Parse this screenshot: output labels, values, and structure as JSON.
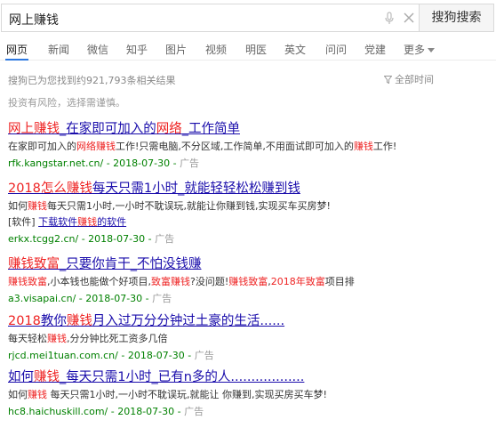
{
  "search": {
    "query": "网上赚钱",
    "button_label": "搜狗搜索"
  },
  "tabs": [
    {
      "label": "网页"
    },
    {
      "label": "新闻"
    },
    {
      "label": "微信"
    },
    {
      "label": "知乎"
    },
    {
      "label": "图片"
    },
    {
      "label": "视频"
    },
    {
      "label": "明医"
    },
    {
      "label": "英文"
    },
    {
      "label": "问问"
    },
    {
      "label": "党建"
    },
    {
      "label": "更多"
    }
  ],
  "stats": {
    "text": "搜狗已为您找到约921,793条相关结果",
    "filter_label": "全部时间"
  },
  "notice": "投资有风险，选择需谨慎。",
  "results": [
    {
      "title": [
        {
          "t": "网上赚钱",
          "h": true
        },
        {
          "t": "_在家即可加入的",
          "h": false
        },
        {
          "t": "网络",
          "h": true
        },
        {
          "t": "_工作简单",
          "h": false
        }
      ],
      "desc": [
        {
          "t": "在家即可加入的",
          "h": false
        },
        {
          "t": "网络赚钱",
          "h": true
        },
        {
          "t": "工作!只需电脑,不分区域,工作简单,不用面试即可加入的",
          "h": false
        },
        {
          "t": "赚钱",
          "h": true
        },
        {
          "t": "工作!",
          "h": false
        }
      ],
      "url": "rfk.kangstar.net.cn/",
      "date": " - 2018-07-30 - ",
      "ad": "广告"
    },
    {
      "title": [
        {
          "t": "2018怎么",
          "h": true
        },
        {
          "t": "赚钱",
          "h": true
        },
        {
          "t": "每天只需1小时_就能轻轻松松",
          "h": false
        },
        {
          "t": "赚到钱",
          "h": false
        }
      ],
      "desc": [
        {
          "t": "如何",
          "h": false
        },
        {
          "t": "赚钱",
          "h": true
        },
        {
          "t": "每天只需1小时,一小时不耽误玩,就能让你赚到钱,实现买车买房梦!",
          "h": false
        }
      ],
      "sub_prefix": "[软件] ",
      "sub_link": [
        {
          "t": "下载软件",
          "h": false
        },
        {
          "t": "赚钱",
          "h": true
        },
        {
          "t": "的软件",
          "h": false
        }
      ],
      "url": "erkx.tcgg2.cn/",
      "date": " - 2018-07-30 - ",
      "ad": "广告"
    },
    {
      "title": [
        {
          "t": "赚钱致富",
          "h": true
        },
        {
          "t": "_只要你肯干_不怕没钱赚",
          "h": false
        }
      ],
      "desc": [
        {
          "t": "赚钱致富",
          "h": true
        },
        {
          "t": ",小本钱也能做个好项目,",
          "h": false
        },
        {
          "t": "致富赚钱",
          "h": true
        },
        {
          "t": "?没问题!",
          "h": false
        },
        {
          "t": "赚钱致富",
          "h": true
        },
        {
          "t": ",",
          "h": false
        },
        {
          "t": "2018年致富",
          "h": true
        },
        {
          "t": "项目排",
          "h": false
        }
      ],
      "url": "a3.visapai.cn/",
      "date": " - 2018-07-30 - ",
      "ad": "广告"
    },
    {
      "title": [
        {
          "t": "2018",
          "h": true
        },
        {
          "t": "教你",
          "h": false
        },
        {
          "t": "赚钱",
          "h": true
        },
        {
          "t": "月入过万分分钟过土豪的生活......",
          "h": false
        }
      ],
      "desc": [
        {
          "t": "每天轻松",
          "h": false
        },
        {
          "t": "赚钱",
          "h": true
        },
        {
          "t": ",分分钟比死工资多几倍",
          "h": false
        }
      ],
      "url": "rjcd.mei1tuan.com.cn/",
      "date": " - 2018-07-30 - ",
      "ad": "广告"
    },
    {
      "title": [
        {
          "t": "如何",
          "h": false
        },
        {
          "t": "赚钱",
          "h": true
        },
        {
          "t": "_每天只需1小时_已有n多的人..................",
          "h": false
        }
      ],
      "desc": [
        {
          "t": "如何",
          "h": false
        },
        {
          "t": "赚钱",
          "h": true
        },
        {
          "t": " 每天只需1小时,一小时不耽误玩,就能让 你赚到,实现买房买车梦!",
          "h": false
        }
      ],
      "url": "hc8.haichuskill.com/",
      "date": " - 2018-07-30 - ",
      "ad": "广告"
    }
  ]
}
